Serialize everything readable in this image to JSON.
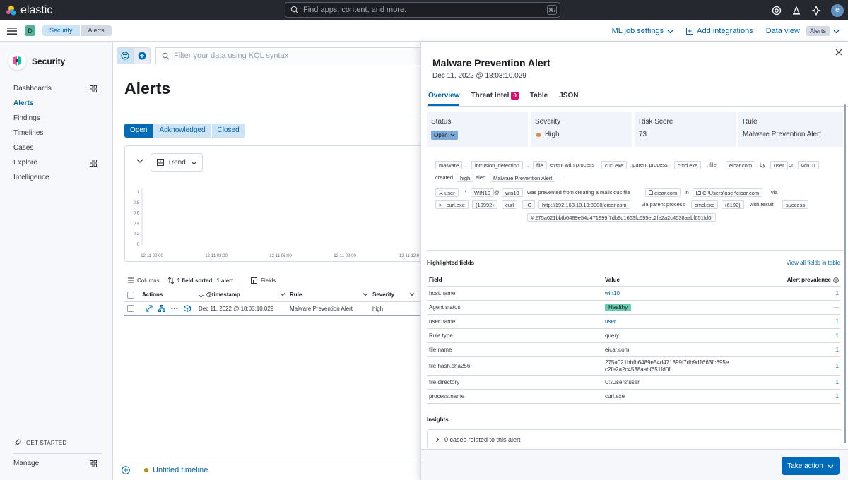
{
  "app": {
    "brand": "elastic",
    "search_placeholder": "Find apps, content, and more.",
    "search_shortcut": "⌘/",
    "avatar_letter": "e"
  },
  "header": {
    "space_letter": "D",
    "breadcrumbs": [
      "Security",
      "Alerts"
    ],
    "ml_job_settings": "ML job settings",
    "add_integrations": "Add integrations",
    "data_view_label": "Data view",
    "data_view_value": "Alerts"
  },
  "sidebar": {
    "title": "Security",
    "items": [
      {
        "label": "Dashboards",
        "grid": true
      },
      {
        "label": "Alerts",
        "active": true
      },
      {
        "label": "Findings"
      },
      {
        "label": "Timelines"
      },
      {
        "label": "Cases"
      },
      {
        "label": "Explore",
        "grid": true
      },
      {
        "label": "Intelligence"
      }
    ],
    "get_started": "GET STARTED",
    "manage": "Manage"
  },
  "main": {
    "kql_placeholder": "Filter your data using KQL syntax",
    "title": "Alerts",
    "status_filters": [
      "Open",
      "Acknowledged",
      "Closed"
    ],
    "trend_label": "Trend",
    "chart_y_ticks": [
      "1",
      "0.8",
      "0.6",
      "0.4",
      "0.2",
      "0"
    ],
    "chart_x_ticks": [
      "12-11 00:00",
      "12-11 03:00",
      "12-11 06:00",
      "12-11 09:00",
      "12-11 12:0"
    ],
    "toolbar": {
      "columns": "Columns",
      "sorted": "1 field sorted",
      "alerts_count": "1 alert",
      "fields": "Fields"
    },
    "table": {
      "headers": {
        "actions": "Actions",
        "timestamp": "@timestamp",
        "rule": "Rule",
        "severity": "Severity"
      },
      "row": {
        "timestamp": "Dec 11, 2022 @ 18:03:10.029",
        "rule": "Malware Prevention Alert",
        "severity": "high"
      }
    },
    "timeline": "Untitled timeline"
  },
  "flyout": {
    "title": "Malware Prevention Alert",
    "date": "Dec 11, 2022 @ 18:03:10.029",
    "tabs": [
      "Overview",
      "Threat Intel",
      "Table",
      "JSON"
    ],
    "threat_intel_count": "0",
    "cards": {
      "status_label": "Status",
      "status_value": "Open",
      "severity_label": "Severity",
      "severity_value": "High",
      "risk_label": "Risk Score",
      "risk_value": "73",
      "rule_label": "Rule",
      "rule_value": "Malware Prevention Alert"
    },
    "reason": {
      "malware": "malware",
      "comma1": ",",
      "intrusion": "intrusion_detection",
      "comma2": ",",
      "file": "file",
      "event_with_process": "event with process",
      "curl_exe": "curl.exe",
      "comma_parent": ", parent process",
      "cmd_exe": "cmd.exe",
      "comma_file": ", file",
      "eicar": "eicar.com",
      "comma_by": ", by",
      "user": "user",
      "on": "on",
      "win10": "win10",
      "created": "created",
      "high": "high",
      "alert": "alert",
      "rule_name": "Malware Prevention Alert",
      "period": ".",
      "l2_user": "user",
      "l2_bs": "\\",
      "l2_WIN10": "WIN10",
      "l2_at": "@",
      "l2_win10": "win10",
      "l2_prevented": "was prevented from creating a malicious file",
      "l2_eicar": "eicar.com",
      "l2_in": "in",
      "l2_path": "C:\\Users\\user\\eicar.com",
      "l2_via": "via",
      "l3_curl": "curl.exe",
      "l3_pid": "(10992)",
      "l3_curlw": "curl",
      "l3_O": "-O",
      "l3_url": "http://192.168.10.10:8000/eicar.com",
      "l3_via_parent": "via parent process",
      "l3_cmd": "cmd.exe",
      "l3_ppid": "(6192)",
      "l3_with_result": "with result",
      "l3_success": "success",
      "l4_hash": "275a021bbfb6489e54d471899f7db9d1663fc695ec2fe2a2c4538aabf651fd0f"
    },
    "highlighted": {
      "title": "Highlighted fields",
      "view_all": "View all fields in table",
      "headers": {
        "field": "Field",
        "value": "Value",
        "prevalence": "Alert prevalence"
      },
      "rows": [
        {
          "field": "host.name",
          "value": "win10",
          "prevalence": "1",
          "link": true
        },
        {
          "field": "Agent status",
          "value": "Healthy",
          "prevalence": "—",
          "badge": true
        },
        {
          "field": "user.name",
          "value": "user",
          "prevalence": "1",
          "link": true
        },
        {
          "field": "Rule type",
          "value": "query",
          "prevalence": "1"
        },
        {
          "field": "file.name",
          "value": "eicar.com",
          "prevalence": "1"
        },
        {
          "field": "file.hash.sha256",
          "value": "275a021bbfb6489e54d471899f7db9d1663fc695e",
          "value2": "c2fe2a2c4538aabf651fd0f",
          "prevalence": "1"
        },
        {
          "field": "file.directory",
          "value": "C:\\Users\\user",
          "prevalence": "1"
        },
        {
          "field": "process.name",
          "value": "curl.exe",
          "prevalence": "1"
        }
      ]
    },
    "insights_title": "Insights",
    "insights_case": "0 cases related to this alert",
    "take_action": "Take action"
  }
}
